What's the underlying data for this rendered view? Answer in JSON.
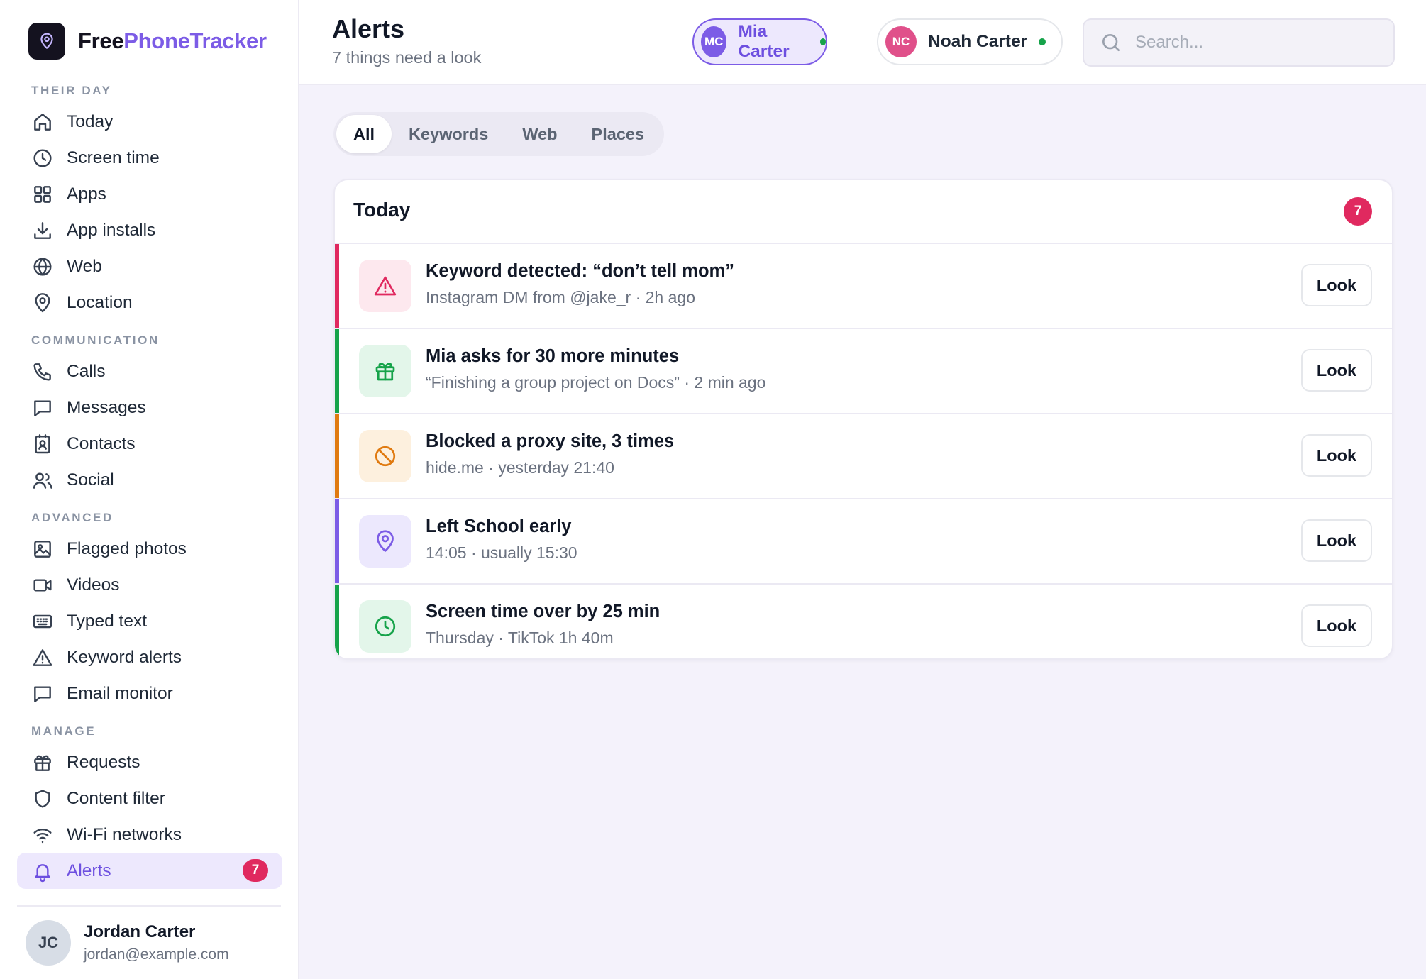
{
  "brand": {
    "part1": "Free",
    "part2": "PhoneTracker"
  },
  "nav": {
    "sections": [
      {
        "title": "THEIR DAY",
        "items": [
          {
            "label": "Today",
            "icon": "home-icon"
          },
          {
            "label": "Screen time",
            "icon": "clock-icon"
          },
          {
            "label": "Apps",
            "icon": "grid-icon"
          },
          {
            "label": "App installs",
            "icon": "download-icon"
          },
          {
            "label": "Web",
            "icon": "globe-icon"
          },
          {
            "label": "Location",
            "icon": "map-pin-icon"
          }
        ]
      },
      {
        "title": "COMMUNICATION",
        "items": [
          {
            "label": "Calls",
            "icon": "phone-icon"
          },
          {
            "label": "Messages",
            "icon": "message-icon"
          },
          {
            "label": "Contacts",
            "icon": "contact-card-icon"
          },
          {
            "label": "Social",
            "icon": "users-icon"
          }
        ]
      },
      {
        "title": "ADVANCED",
        "items": [
          {
            "label": "Flagged photos",
            "icon": "image-icon"
          },
          {
            "label": "Videos",
            "icon": "video-icon"
          },
          {
            "label": "Typed text",
            "icon": "keyboard-icon"
          },
          {
            "label": "Keyword alerts",
            "icon": "warning-icon"
          },
          {
            "label": "Email monitor",
            "icon": "message-icon"
          }
        ]
      },
      {
        "title": "MANAGE",
        "items": [
          {
            "label": "Requests",
            "icon": "gift-icon"
          },
          {
            "label": "Content filter",
            "icon": "shield-icon"
          },
          {
            "label": "Wi-Fi networks",
            "icon": "wifi-icon"
          },
          {
            "label": "Alerts",
            "icon": "bell-icon",
            "active": true,
            "badge": "7"
          }
        ]
      }
    ]
  },
  "user": {
    "initials": "JC",
    "name": "Jordan Carter",
    "email": "jordan@example.com"
  },
  "header": {
    "title": "Alerts",
    "subtitle": "7 things need a look"
  },
  "kids": [
    {
      "initials": "MC",
      "name": "Mia Carter",
      "active": true,
      "color": "#7c5ce6"
    },
    {
      "initials": "NC",
      "name": "Noah Carter",
      "active": false,
      "color": "#e0508a"
    }
  ],
  "search": {
    "placeholder": "Search..."
  },
  "tabs": [
    {
      "label": "All",
      "active": true
    },
    {
      "label": "Keywords"
    },
    {
      "label": "Web"
    },
    {
      "label": "Places"
    }
  ],
  "panel": {
    "title": "Today",
    "count": "7"
  },
  "alerts": [
    {
      "title": "Keyword detected: “don’t tell mom”",
      "subtitle": "Instagram DM from @jake_r · 2h ago",
      "icon": "warning-icon",
      "accent": "#e0295f",
      "tint": "#fde8ee",
      "button": "Look"
    },
    {
      "title": "Mia asks for 30 more minutes",
      "subtitle": "“Finishing a group project on Docs” · 2 min ago",
      "icon": "gift-icon",
      "accent": "#16a34a",
      "tint": "#e3f6ea",
      "button": "Look"
    },
    {
      "title": "Blocked a proxy site, 3 times",
      "subtitle": "hide.me · yesterday 21:40",
      "icon": "blocked-icon",
      "accent": "#e07a10",
      "tint": "#fdf0de",
      "button": "Look"
    },
    {
      "title": "Left School early",
      "subtitle": "14:05 · usually 15:30",
      "icon": "map-pin-icon",
      "accent": "#7c5ce6",
      "tint": "#ece8fd",
      "button": "Look"
    },
    {
      "title": "Screen time over by 25 min",
      "subtitle": "Thursday · TikTok 1h 40m",
      "icon": "clock-icon",
      "accent": "#16a34a",
      "tint": "#e3f6ea",
      "button": "Look"
    }
  ],
  "colors": {
    "accent": "#7c5ce6",
    "alert_badge": "#e0295f",
    "online": "#16a34a"
  }
}
